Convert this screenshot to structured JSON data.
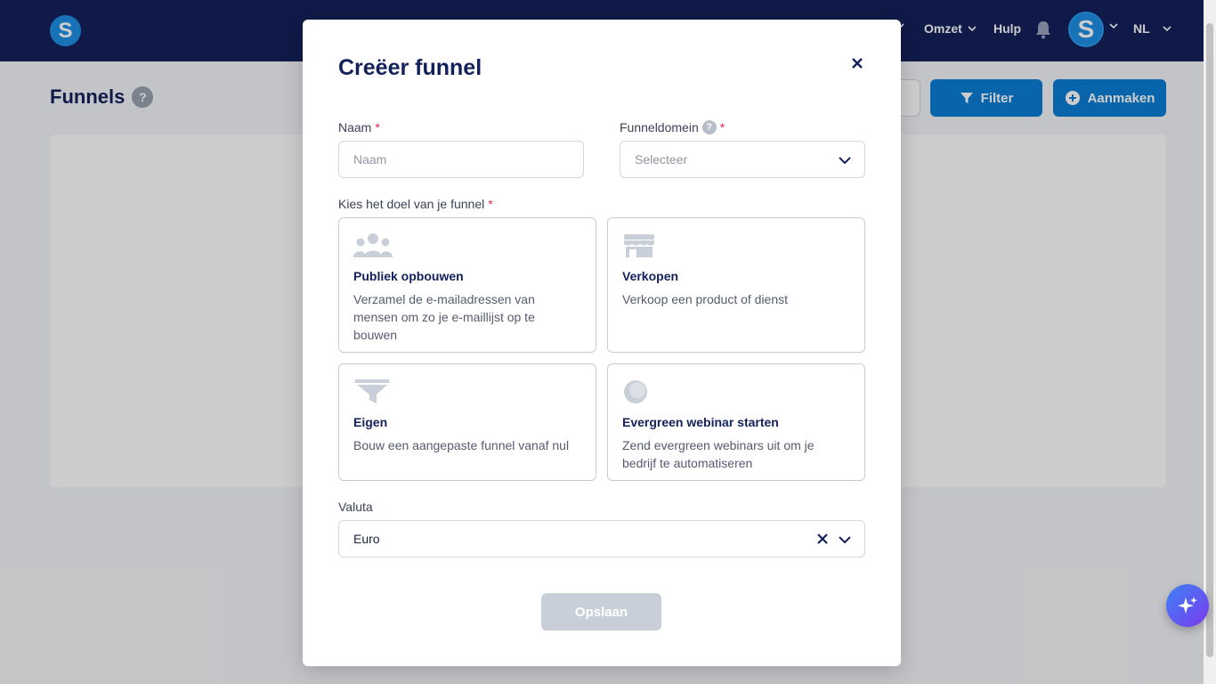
{
  "topbar": {
    "logo_letter": "S",
    "nav": [
      {
        "label": "Omzet"
      },
      {
        "label": "Hulp"
      }
    ],
    "avatar_letter": "S",
    "language": "NL"
  },
  "page": {
    "title": "Funnels",
    "help": "?",
    "filter_label": "Filter",
    "create_label": "Aanmaken"
  },
  "modal": {
    "title": "Creëer funnel",
    "close": "×",
    "name_label": "Naam",
    "name_placeholder": "Naam",
    "domain_label": "Funneldomein",
    "domain_help": "?",
    "domain_placeholder": "Selecteer",
    "required_mark": "*",
    "goal_label": "Kies het doel van je funnel",
    "goals": [
      {
        "title": "Publiek opbouwen",
        "desc": "Verzamel de e-mailadressen van mensen om zo je e-maillijst op te bouwen"
      },
      {
        "title": "Verkopen",
        "desc": "Verkoop een product of dienst"
      },
      {
        "title": "Eigen",
        "desc": "Bouw een aangepaste funnel vanaf nul"
      },
      {
        "title": "Evergreen webinar starten",
        "desc": "Zend evergreen webinars uit om je bedrijf te automatiseren"
      }
    ],
    "currency_label": "Valuta",
    "currency_value": "Euro",
    "save_label": "Opslaan"
  },
  "colors": {
    "navy": "#13215b",
    "primary": "#0b7fd6",
    "required": "#e02b4a"
  }
}
